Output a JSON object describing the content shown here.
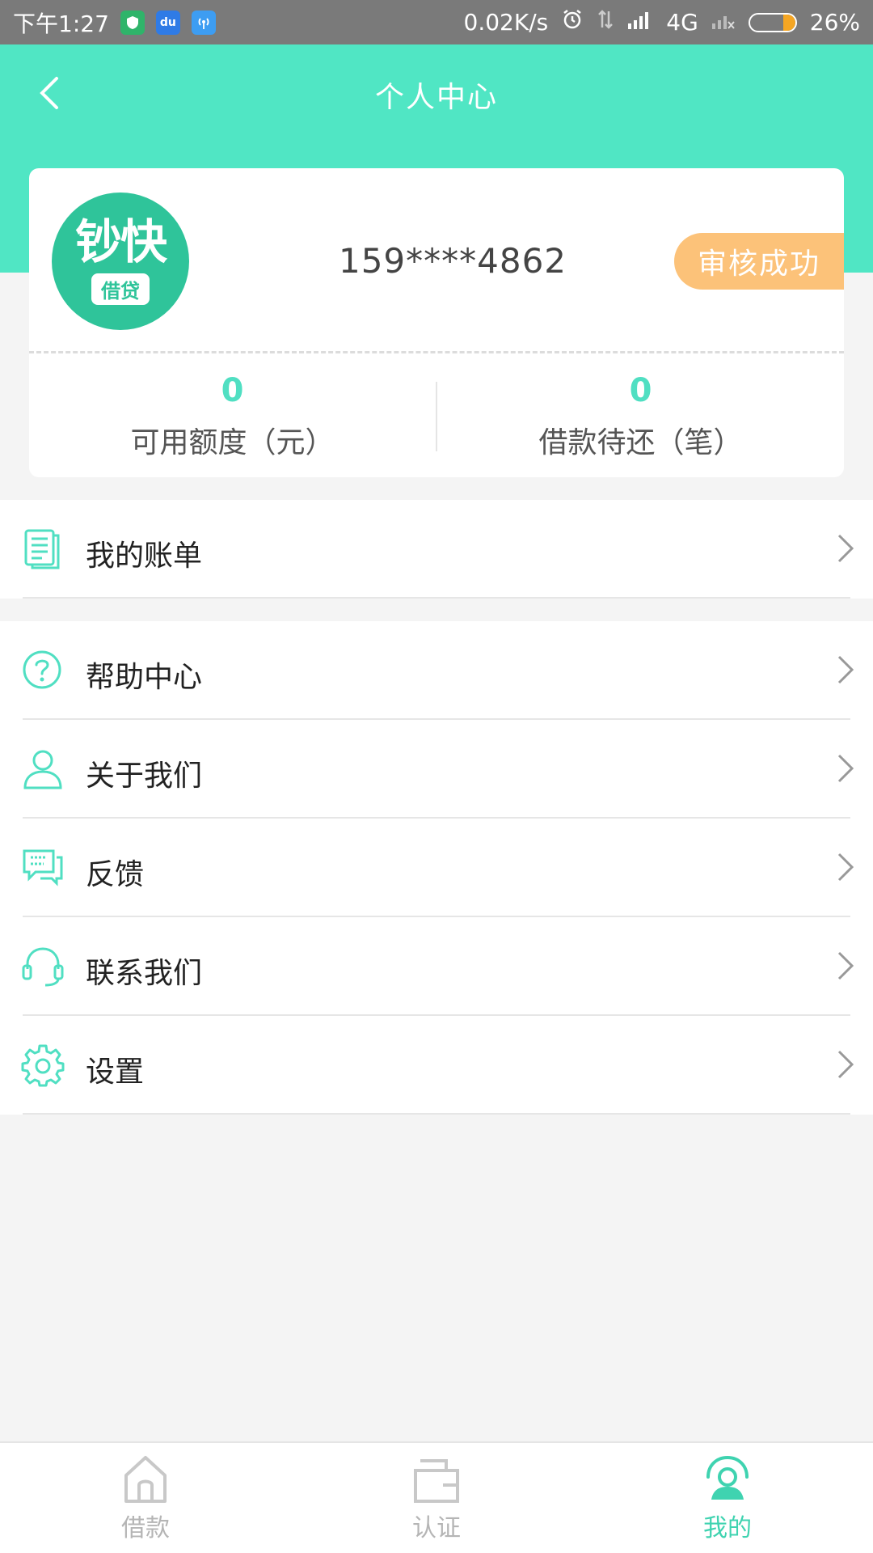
{
  "status_bar": {
    "time": "下午1:27",
    "icon_du": "du",
    "net_speed": "0.02K/s",
    "network": "4G",
    "battery": "26%",
    "battery_level": 0.26
  },
  "header": {
    "title": "个人中心"
  },
  "profile": {
    "logo_main": "钞快",
    "logo_sub": "借贷",
    "phone": "159****4862",
    "status_badge": "审核成功",
    "stats": [
      {
        "value": "0",
        "label": "可用额度（元）"
      },
      {
        "value": "0",
        "label": "借款待还（笔）"
      }
    ]
  },
  "menu": {
    "group1": [
      {
        "label": "我的账单",
        "icon": "bill-icon"
      }
    ],
    "group2": [
      {
        "label": "帮助中心",
        "icon": "help-icon"
      },
      {
        "label": "关于我们",
        "icon": "user-icon"
      },
      {
        "label": "反馈",
        "icon": "feedback-icon"
      },
      {
        "label": "联系我们",
        "icon": "headset-icon"
      },
      {
        "label": "设置",
        "icon": "gear-icon"
      }
    ]
  },
  "tabbar": {
    "tabs": [
      {
        "label": "借款",
        "icon": "home-icon",
        "active": false
      },
      {
        "label": "认证",
        "icon": "wallet-icon",
        "active": false
      },
      {
        "label": "我的",
        "icon": "profile-icon",
        "active": true
      }
    ]
  },
  "colors": {
    "accent": "#50e6c4",
    "badge": "#fcc279",
    "active_tab": "#3fd3b0",
    "inactive_tab": "#b5b5b5"
  }
}
